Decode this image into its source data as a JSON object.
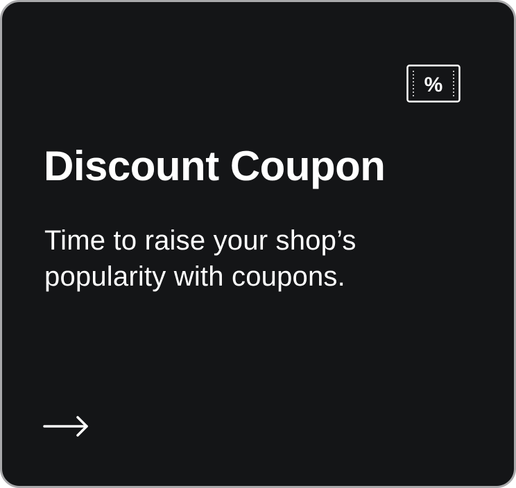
{
  "card": {
    "icon": "coupon-percent-icon",
    "icon_symbol": "%",
    "title": "Discount Coupon",
    "description": "Time to raise your shop’s popularity with coupons.",
    "action_icon": "arrow-right-icon"
  },
  "colors": {
    "card_background": "#141517",
    "card_border": "#a9a9ab",
    "text": "#ffffff"
  }
}
